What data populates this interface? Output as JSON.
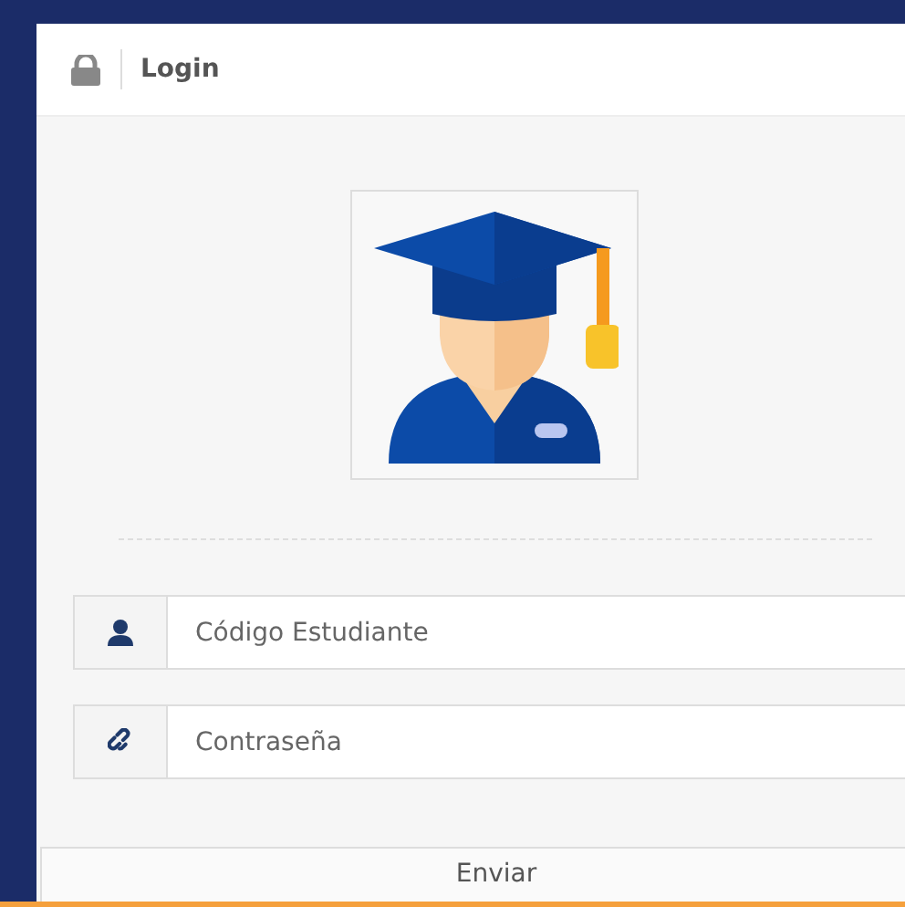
{
  "header": {
    "title": "Login"
  },
  "fields": [
    {
      "kind": "user",
      "placeholder": "Código Estudiante"
    },
    {
      "kind": "password",
      "placeholder": "Contraseña"
    }
  ],
  "submit": {
    "label": "Enviar"
  }
}
